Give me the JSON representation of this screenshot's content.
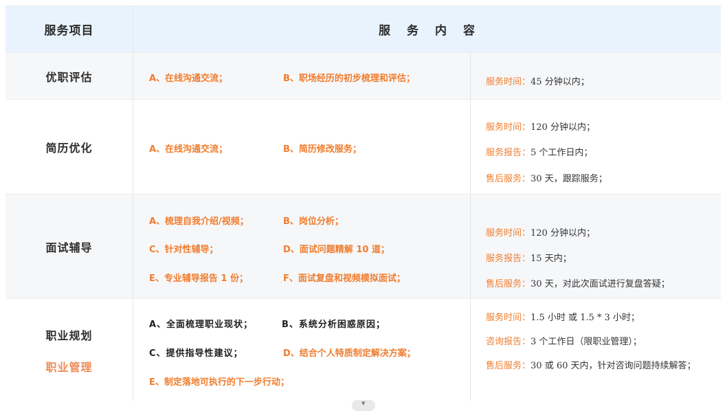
{
  "header": {
    "col1": "服务项目",
    "col2": "服务内容"
  },
  "rows": [
    {
      "category": "优职评估",
      "services": [
        "A、在线沟通交流；",
        "B、职场经历的初步梳理和评估；"
      ],
      "info": [
        {
          "k": "服务时间：",
          "v": "45 分钟以内；"
        }
      ]
    },
    {
      "category": "简历优化",
      "services": [
        "A、在线沟通交流；",
        "B、简历修改服务；"
      ],
      "info": [
        {
          "k": "服务时间：",
          "v": "120 分钟以内；"
        },
        {
          "k": "服务报告：",
          "v": "5 个工作日内；"
        },
        {
          "k": "售后服务：",
          "v": "30 天，跟踪服务；"
        }
      ]
    },
    {
      "category": "面试辅导",
      "services": [
        "A、梳理自我介绍/视频；",
        "B、岗位分析；",
        "C、针对性辅导；",
        "D、面试问题精解 10 道；",
        "E、专业辅导报告 1 份；",
        "F、面试复盘和视频模拟面试；"
      ],
      "info": [
        {
          "k": "服务时间：",
          "v": "120 分钟以内；"
        },
        {
          "k": "服务报告：",
          "v": "15 天内；"
        },
        {
          "k": "售后服务：",
          "v": "30 天，对此次面试进行复盘答疑；"
        }
      ]
    },
    {
      "category": "职业规划",
      "category_sub": "职业管理",
      "services": [
        "A、全面梳理职业现状；",
        "B、系统分析困惑原因；",
        "C、提供指导性建议；",
        "D、结合个人特质制定解决方案；",
        "E、制定落地可执行的下一步行动；"
      ],
      "info": [
        {
          "k": "服务时间：",
          "v": "1.5 小时  或  1.5 * 3 小时；"
        },
        {
          "k": "咨询报告：",
          "v": "3 个工作日（限职业管理）；"
        },
        {
          "k": "售后服务：",
          "v": "30 或 60 天内，针对咨询问题持续解答；"
        }
      ]
    }
  ],
  "icons": {
    "scroll": "chevron-down-icon"
  },
  "colors": {
    "accent": "#f07d2e",
    "header_bg": "#e8f3fd",
    "sub_accent": "#f08a55"
  }
}
